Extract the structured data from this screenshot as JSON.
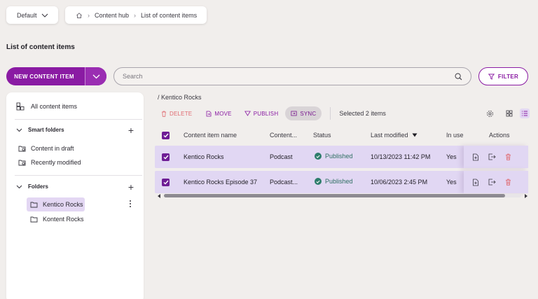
{
  "topbar": {
    "channel": "Default",
    "breadcrumb": [
      "Content hub",
      "List of content items"
    ]
  },
  "page": {
    "title": "List of content items"
  },
  "actions": {
    "new_item": "NEW CONTENT ITEM",
    "search_placeholder": "Search",
    "filter": "FILTER"
  },
  "sidebar": {
    "all_items": "All content items",
    "smart_folders": {
      "heading": "Smart folders",
      "items": [
        "Content in draft",
        "Recently modified"
      ]
    },
    "folders": {
      "heading": "Folders",
      "items": [
        "Kentico Rocks",
        "Kontent Rocks"
      ],
      "selected": "Kentico Rocks"
    }
  },
  "main": {
    "path": "/ Kentico Rocks",
    "toolbar": {
      "delete": "DELETE",
      "move": "MOVE",
      "publish": "PUBLISH",
      "sync": "SYNC",
      "selected": "Selected 2 items"
    },
    "columns": [
      "Content item name",
      "Content...",
      "Status",
      "Last modified",
      "In use",
      "Actions"
    ],
    "rows": [
      {
        "name": "Kentico Rocks",
        "type": "Podcast",
        "status": "Published",
        "modified": "10/13/2023 11:42 PM",
        "in_use": "Yes"
      },
      {
        "name": "Kentico Rocks Episode 37",
        "type": "Podcast...",
        "status": "Published",
        "modified": "10/06/2023 2:45 PM",
        "in_use": "Yes"
      }
    ]
  },
  "colors": {
    "accent": "#8a1ba3",
    "selection": "#e1d7f3",
    "published": "#2e7d6b",
    "danger": "#e06a70"
  }
}
